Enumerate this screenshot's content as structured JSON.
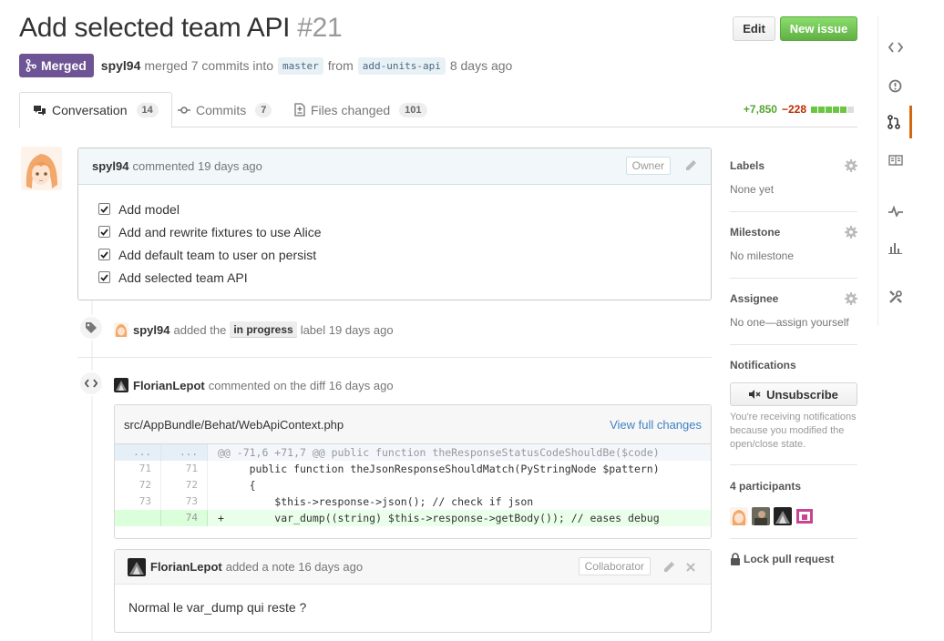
{
  "header": {
    "title": "Add selected team API",
    "number": "#21",
    "edit_label": "Edit",
    "new_issue_label": "New issue"
  },
  "meta": {
    "state": "Merged",
    "author": "spyl94",
    "text_merged": "merged 7 commits into",
    "base_branch": "master",
    "text_from": "from",
    "head_branch": "add-units-api",
    "time": "8 days ago"
  },
  "tabs": [
    {
      "label": "Conversation",
      "count": "14",
      "icon": "conversation-icon"
    },
    {
      "label": "Commits",
      "count": "7",
      "icon": "commit-icon"
    },
    {
      "label": "Files changed",
      "count": "101",
      "icon": "file-diff-icon"
    }
  ],
  "diffstat": {
    "additions": "+7,850",
    "deletions": "−228"
  },
  "comment": {
    "author": "spyl94",
    "action": "commented 19 days ago",
    "role": "Owner",
    "tasks": [
      "Add model",
      "Add and rewrite fixtures to use Alice",
      "Add default team to user on persist",
      "Add selected team API"
    ]
  },
  "label_event": {
    "actor": "spyl94",
    "text_before": "added the",
    "label": "in progress",
    "text_after": "label 19 days ago"
  },
  "diff_event": {
    "actor": "FlorianLepot",
    "text": "commented on the diff 16 days ago",
    "file": "src/AppBundle/Behat/WebApiContext.php",
    "view_label": "View full changes",
    "lines": [
      {
        "type": "hunk",
        "old": "...",
        "new": "...",
        "code": "@@ -71,6 +71,7 @@ public function theResponseStatusCodeShouldBe($code)"
      },
      {
        "type": "ctx",
        "old": "71",
        "new": "71",
        "code": "     public function theJsonResponseShouldMatch(PyStringNode $pattern)"
      },
      {
        "type": "ctx",
        "old": "72",
        "new": "72",
        "code": "     {"
      },
      {
        "type": "ctx",
        "old": "73",
        "new": "73",
        "code": "         $this->response->json(); // check if json"
      },
      {
        "type": "add",
        "old": "",
        "new": "74",
        "code": "+        var_dump((string) $this->response->getBody()); // eases debug"
      }
    ]
  },
  "note": {
    "author": "FlorianLepot",
    "action": "added a note 16 days ago",
    "role": "Collaborator",
    "body": "Normal le var_dump qui reste ?"
  },
  "sidebar": {
    "labels_title": "Labels",
    "labels_value": "None yet",
    "milestone_title": "Milestone",
    "milestone_value": "No milestone",
    "assignee_title": "Assignee",
    "assignee_value": "No one—assign yourself",
    "notifications_title": "Notifications",
    "unsubscribe_label": "Unsubscribe",
    "notifications_note": "You're receiving notifications because you modified the open/close state.",
    "participants_title": "4 participants",
    "lock_label": "Lock pull request"
  },
  "repo_nav": [
    "code-icon",
    "issues-icon",
    "pull-request-icon",
    "wiki-icon",
    "pulse-icon",
    "graphs-icon",
    "settings-icon"
  ],
  "colors": {
    "merged": "#6e5494",
    "new_issue": "#6cc644",
    "additions": "#55a532",
    "deletions": "#bd2c00",
    "link": "#4183c4",
    "repo_nav_active": "#d26911"
  }
}
